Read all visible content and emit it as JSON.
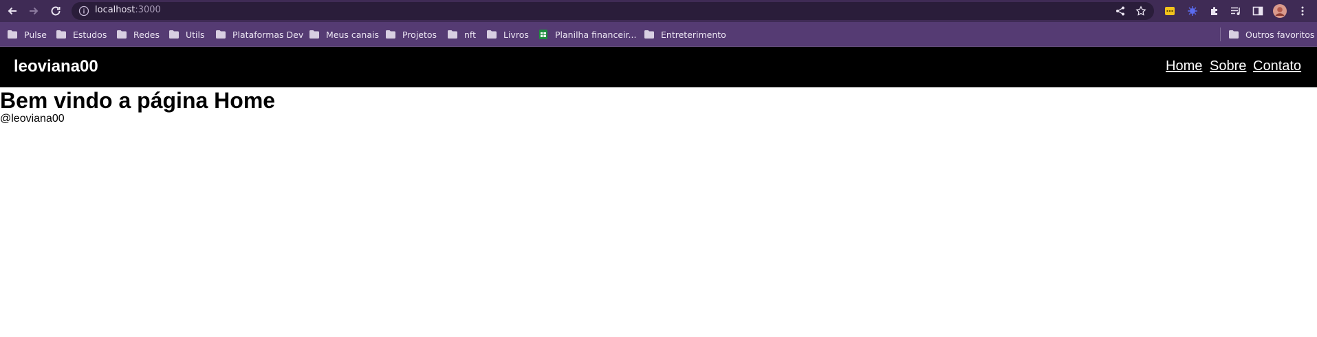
{
  "browser": {
    "url_host": "localhost",
    "url_port": ":3000",
    "bookmarks": [
      {
        "label": "Pulse",
        "icon": "folder-icon"
      },
      {
        "label": "Estudos",
        "icon": "folder-icon"
      },
      {
        "label": "Redes",
        "icon": "folder-icon"
      },
      {
        "label": "Utils",
        "icon": "folder-icon"
      },
      {
        "label": "Plataformas Dev",
        "icon": "folder-icon"
      },
      {
        "label": "Meus canais",
        "icon": "folder-icon"
      },
      {
        "label": "Projetos",
        "icon": "folder-icon"
      },
      {
        "label": "nft",
        "icon": "folder-icon"
      },
      {
        "label": "Livros",
        "icon": "folder-icon"
      },
      {
        "label": "Planilha financeir...",
        "icon": "sheets-icon"
      },
      {
        "label": "Entreterimento",
        "icon": "folder-icon"
      }
    ],
    "other_bookmarks": "Outros favoritos"
  },
  "header": {
    "brand": "leoviana00",
    "nav": [
      "Home",
      "Sobre",
      "Contato"
    ]
  },
  "main": {
    "title": "Bem vindo a página Home"
  },
  "footer": {
    "text": "@leoviana00"
  },
  "colors": {
    "toolbar": "#3f2b55",
    "omnibox": "#2a1d3a",
    "bookmarks_bar": "#553b73",
    "page_header": "#000000"
  }
}
